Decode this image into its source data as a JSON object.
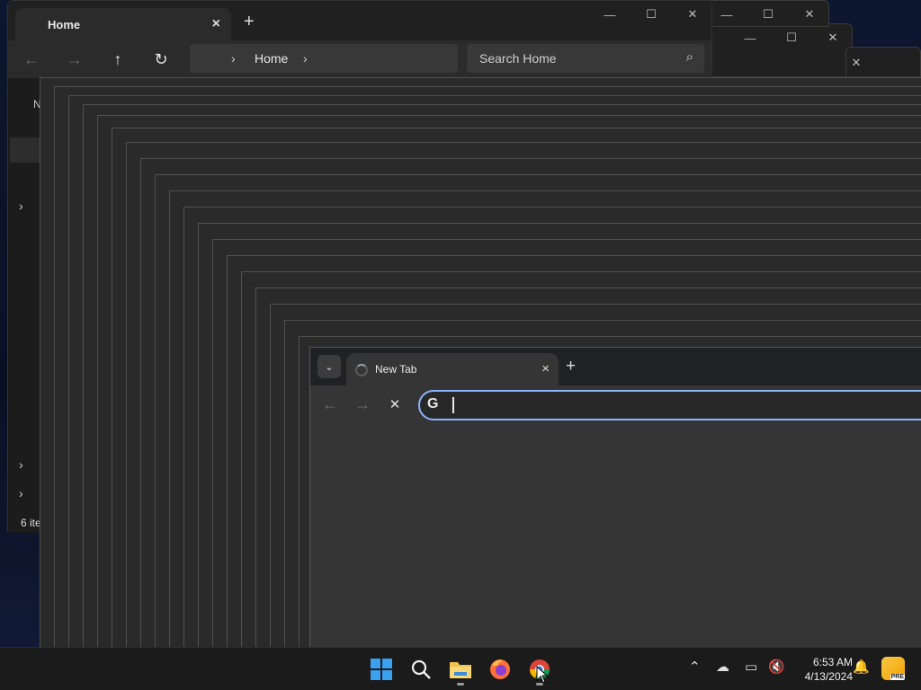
{
  "explorer": {
    "tab_title": "Home",
    "address_path": "Home",
    "search_placeholder": "Search Home",
    "sidebar_label_partial": "N",
    "status_text": "6 ite"
  },
  "chrome": {
    "tab_title": "New Tab",
    "google_letter": "G"
  },
  "taskbar": {
    "apps": [
      "Start",
      "Search",
      "File Explorer",
      "Firefox",
      "Chrome"
    ],
    "time": "6:53 AM",
    "date": "4/13/2024",
    "copilot_badge": "PRE"
  },
  "icons": {
    "close": "×",
    "plus": "+",
    "minimize": "—",
    "maximize": "☐",
    "back": "←",
    "forward": "→",
    "up": "↑",
    "refresh": "↻",
    "chevron_right": "›",
    "chevron_down": "⌄",
    "search": "⌕",
    "stop": "✕"
  },
  "colors": {
    "accent_blue": "#8ab4f8",
    "windows_blue": "#3aa0f0"
  }
}
